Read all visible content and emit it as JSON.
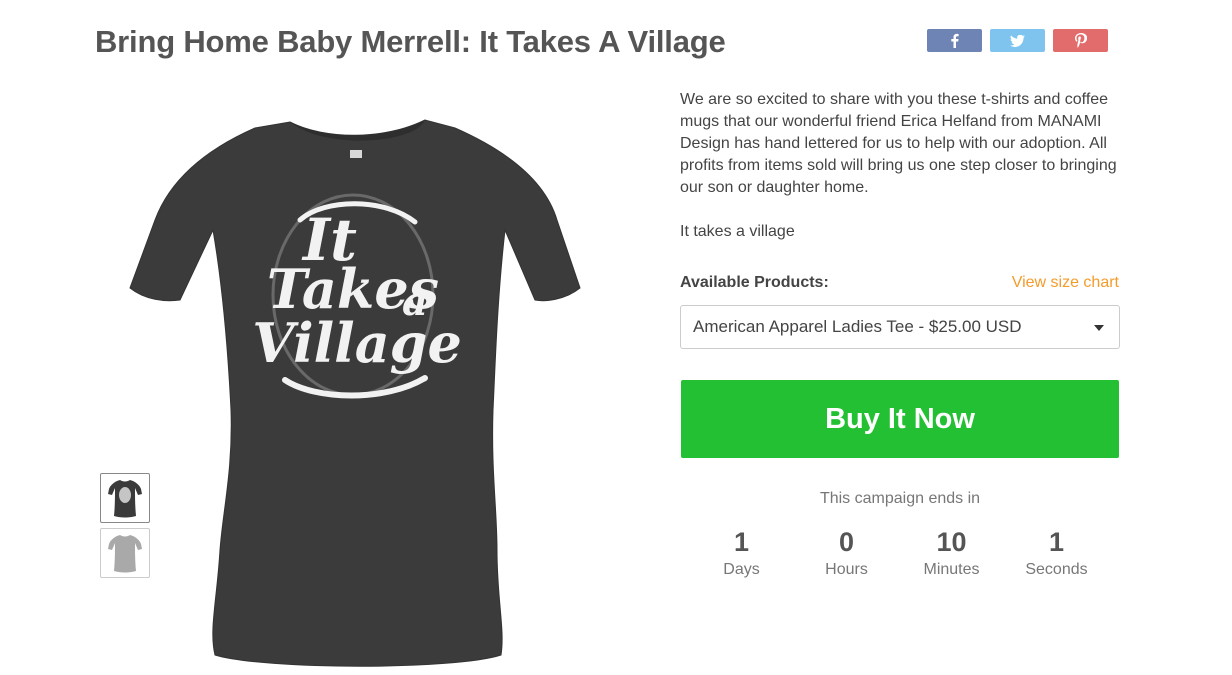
{
  "page": {
    "title": "Bring Home Baby Merrell: It Takes A Village"
  },
  "social": {
    "facebook_icon": "facebook-icon",
    "twitter_icon": "twitter-icon",
    "pinterest_icon": "pinterest-icon"
  },
  "product": {
    "image_icon": "tshirt-image",
    "print_text": [
      "It",
      "Takes",
      "a",
      "Village"
    ],
    "thumbnails": [
      "black-tee-thumbnail",
      "grey-tee-thumbnail"
    ]
  },
  "description": {
    "paragraph1": "We are so excited to share with you these t-shirts and coffee mugs that our wonderful friend Erica Helfand from MANAMI Design has hand lettered for us to help with our adoption. All profits from items sold will bring us one step closer to bringing our son or daughter home.",
    "paragraph2": "It takes a village"
  },
  "products": {
    "label": "Available Products:",
    "size_chart_link": "View size chart",
    "selected": "American Apparel Ladies Tee - $25.00 USD"
  },
  "buy": {
    "label": "Buy It Now",
    "color": "#22c032"
  },
  "campaign": {
    "ends_text": "This campaign ends in",
    "countdown": [
      {
        "value": "1",
        "unit": "Days"
      },
      {
        "value": "0",
        "unit": "Hours"
      },
      {
        "value": "10",
        "unit": "Minutes"
      },
      {
        "value": "1",
        "unit": "Seconds"
      }
    ]
  },
  "colors": {
    "accent_orange": "#f39c2c",
    "facebook": "#6d84b4",
    "twitter": "#7fc3ef",
    "pinterest": "#e26b6b",
    "shirt": "#3a3a3a"
  }
}
